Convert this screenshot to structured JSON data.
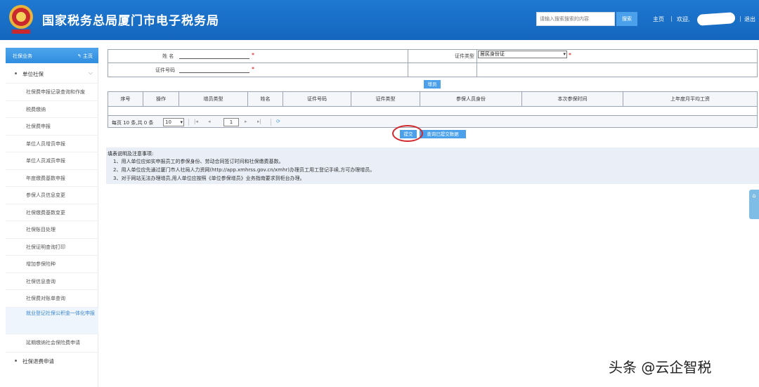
{
  "header": {
    "title": "国家税务总局厦门市电子税务局",
    "search_placeholder": "请输入搜索搜索的内容",
    "search_button": "搜索",
    "nav_home": "主页",
    "nav_welcome": "欢迎,",
    "nav_logout": "退出",
    "separator": "|"
  },
  "sidebar": {
    "head_label": "社保业务",
    "home_label": "主页",
    "group_unit": "单位社保",
    "items": [
      "社保费申报记录查询和作废",
      "税费缴纳",
      "社保费申报",
      "单位人员增员申报",
      "单位人员减员申报",
      "年度缴费基数申报",
      "参保人员信息变更",
      "社保缴费基数变更",
      "社保账目处理",
      "社保证明查询打印",
      "增加参保险种",
      "社保信息查询",
      "社保费对账单查询",
      "就业登记社保公积金一体化申报",
      "延期缴纳社会保险费申请"
    ],
    "group_refund": "社保退费申请"
  },
  "form": {
    "name_label": "姓 名",
    "id_type_label": "证件类型",
    "id_type_value": "居民身份证",
    "id_number_label": "证件号码",
    "required_mark": "*",
    "add_button": "增员"
  },
  "grid": {
    "columns": [
      "序号",
      "操作",
      "增员类型",
      "姓名",
      "证件号码",
      "证件类型",
      "参保人员身份",
      "本次参保时间",
      "上年度月平均工资"
    ]
  },
  "pager": {
    "summary": "每页 10 条,共 0 条",
    "page_size": "10",
    "page": "1"
  },
  "actions": {
    "submit_button": "提交",
    "query_button": "查询已提交数据"
  },
  "notice": {
    "title": "填表说明及注意事项:",
    "lines": [
      "1、用人单位应如实申报员工的参保身份、劳动合同签订时间和社保缴费基数。",
      "2、用人单位应先通过厦门市人社局人力资网(http://app.xmhrss.gov.cn/xmhr)办理员工用工登记手续,方可办理增员。",
      "3、对于网站无法办理增员,用人单位应按照《单位参保增员》业务指南要求到柜台办理。"
    ]
  },
  "watermark": "头条 @云企智税",
  "colors": {
    "header_blue": "#1f78d0",
    "button_blue": "#4aa0ea",
    "annotation_red": "#d0262c"
  }
}
